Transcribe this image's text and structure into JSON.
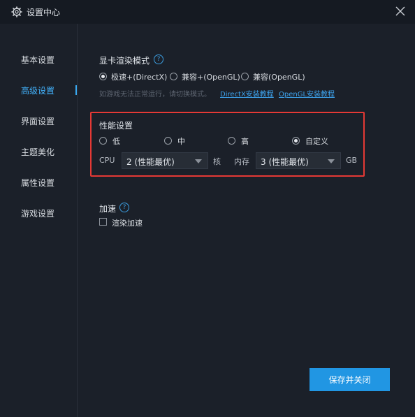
{
  "window": {
    "title": "设置中心"
  },
  "sidebar": {
    "items": [
      {
        "label": "基本设置"
      },
      {
        "label": "高级设置",
        "active": true
      },
      {
        "label": "界面设置"
      },
      {
        "label": "主题美化"
      },
      {
        "label": "属性设置"
      },
      {
        "label": "游戏设置"
      }
    ]
  },
  "render_mode": {
    "title": "显卡渲染模式",
    "options": [
      {
        "label": "极速+(DirectX)",
        "checked": true
      },
      {
        "label": "兼容+(OpenGL)",
        "checked": false
      },
      {
        "label": "兼容(OpenGL)",
        "checked": false
      }
    ],
    "hint": "如游戏无法正常运行，请切换模式。",
    "links": [
      {
        "label": "DirectX安装教程"
      },
      {
        "label": "OpenGL安装教程"
      }
    ]
  },
  "performance": {
    "title": "性能设置",
    "options": [
      {
        "label": "低",
        "checked": false
      },
      {
        "label": "中",
        "checked": false
      },
      {
        "label": "高",
        "checked": false
      },
      {
        "label": "自定义",
        "checked": true
      }
    ],
    "cpu_label": "CPU",
    "cpu_value": "2 (性能最优)",
    "cpu_unit": "核",
    "mem_label": "内存",
    "mem_value": "3 (性能最优)",
    "mem_unit": "GB"
  },
  "acceleration": {
    "title": "加速",
    "checkbox_label": "渲染加速",
    "checked": false
  },
  "footer": {
    "save_label": "保存并关闭"
  },
  "colors": {
    "accent": "#2196e3",
    "highlight_border": "#e53935",
    "active_nav": "#43b4ff",
    "background": "#1b2029"
  }
}
